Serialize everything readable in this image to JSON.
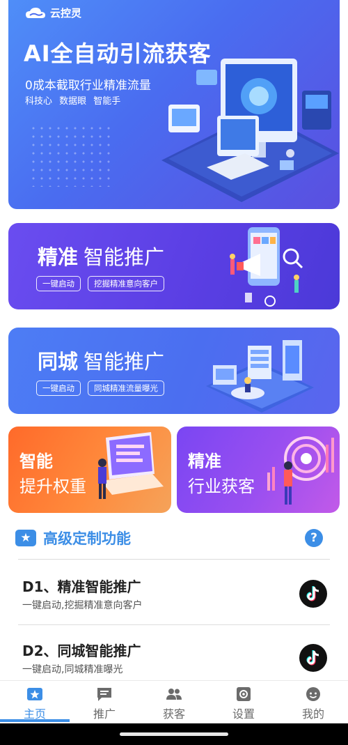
{
  "hero": {
    "brand": "云控灵",
    "headline": "AI全自动引流获客",
    "subtitle": "0成本截取行业精准流量",
    "keywords": "科技心 数据眼 智能手"
  },
  "features": [
    {
      "bold": "精准",
      "title": "智能推广",
      "tags": [
        "一键启动",
        "挖掘精准意向客户"
      ]
    },
    {
      "bold": "同城",
      "title": "智能推广",
      "tags": [
        "一键启动",
        "同城精准流量曝光"
      ]
    }
  ],
  "half_cards": [
    {
      "line1": "智能",
      "line2": "提升权重"
    },
    {
      "line1": "精准",
      "line2": "行业获客"
    }
  ],
  "section": {
    "title": "高级定制功能",
    "help": "?"
  },
  "list": [
    {
      "title": "D1、精准智能推广",
      "subtitle": "一键启动,挖掘精准意向客户",
      "icon": "douyin-icon"
    },
    {
      "title": "D2、同城智能推广",
      "subtitle": "一键启动,同城精准曝光",
      "icon": "douyin-icon"
    }
  ],
  "tabs": [
    {
      "label": "主页",
      "icon": "home-star-icon",
      "active": true
    },
    {
      "label": "推广",
      "icon": "message-icon",
      "active": false
    },
    {
      "label": "获客",
      "icon": "people-icon",
      "active": false
    },
    {
      "label": "设置",
      "icon": "settings-icon",
      "active": false
    },
    {
      "label": "我的",
      "icon": "face-icon",
      "active": false
    }
  ],
  "colors": {
    "accent": "#3c8ee6",
    "hero": "#4a6cf0",
    "card_purple": "#5b3fe4",
    "card_blue": "#4b6ef0",
    "card_orange": "#ff7a32",
    "card_violet": "#9a4ff0"
  }
}
